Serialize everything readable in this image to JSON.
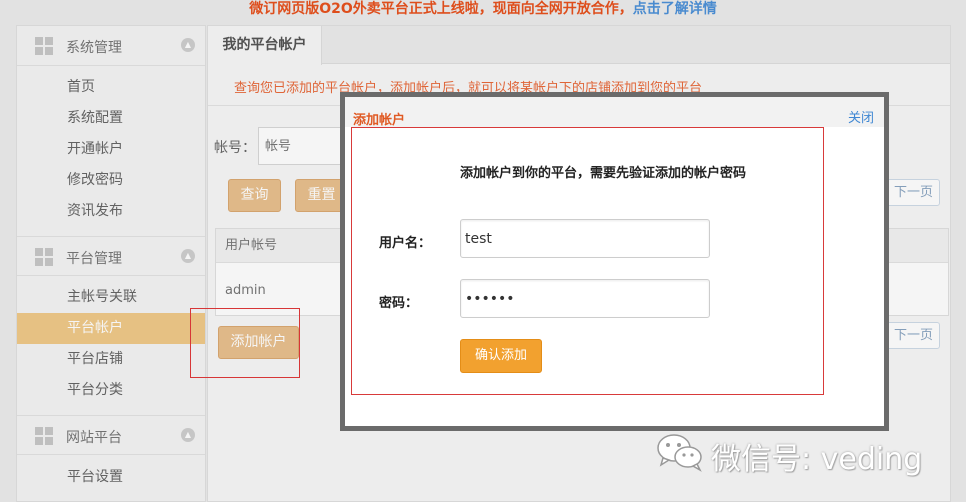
{
  "announcement": {
    "text": "微订网页版O2O外卖平台正式上线啦，现面向全网开放合作，",
    "link": "点击了解详情"
  },
  "sidebar": {
    "sections": [
      {
        "title": "系统管理",
        "toggle": "▲",
        "items": [
          "首页",
          "系统配置",
          "开通帐户",
          "修改密码",
          "资讯发布"
        ]
      },
      {
        "title": "平台管理",
        "toggle": "▲",
        "items": [
          "主帐号关联",
          "平台帐户",
          "平台店铺",
          "平台分类"
        ]
      },
      {
        "title": "网站平台",
        "toggle": "▲",
        "items": [
          "平台设置"
        ]
      }
    ],
    "active_item": "平台帐户"
  },
  "main": {
    "tab": "我的平台帐户",
    "hint": "查询您已添加的平台帐户，添加帐户后，就可以将某帐户下的店铺添加到您的平台",
    "account_label": "帐号：",
    "account_placeholder": "帐号",
    "query_button": "查询",
    "reset_button": "重置",
    "next_page": "下一页",
    "table": {
      "header": "用户帐号",
      "rows": [
        "admin"
      ]
    },
    "add_account_button": "添加帐户"
  },
  "modal": {
    "title": "添加帐户",
    "close": "关闭",
    "description": "添加帐户到你的平台，需要先验证添加的帐户密码",
    "username_label": "用户名：",
    "username_value": "test",
    "password_label": "密码：",
    "password_value": "123456",
    "confirm_button": "确认添加"
  },
  "watermark": {
    "text": "微信号: veding",
    "icon": "wechat-icon"
  },
  "colors": {
    "announce": "#e8521e",
    "link": "#4e91d8",
    "active_nav": "#f0c989",
    "button_tan": "#e9c08e",
    "confirm": "#f2a12f",
    "modal_title": "#e05a24",
    "highlight_border": "#e0393a"
  }
}
